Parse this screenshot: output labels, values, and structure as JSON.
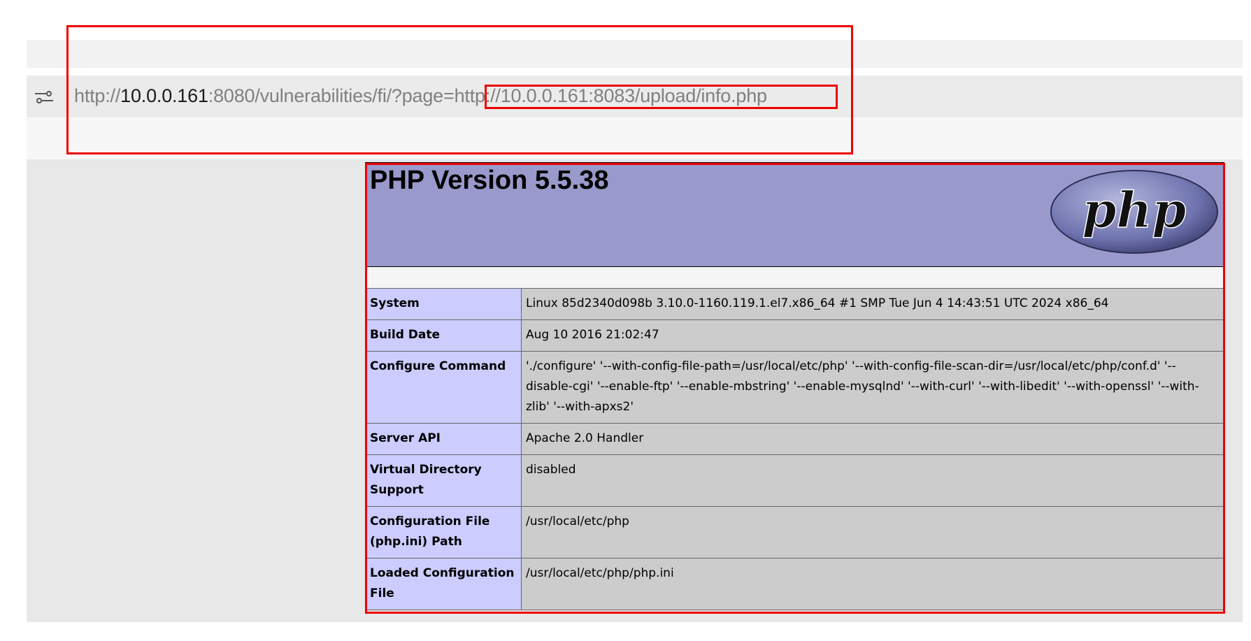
{
  "address_bar": {
    "scheme": "http://",
    "host": "10.0.0.161",
    "path_prefix": ":8080/vulnerabilities/fi/?page=",
    "page_param": "http://10.0.0.161:8083/upload/info.php",
    "site_icon": "site-settings-icon"
  },
  "phpinfo": {
    "title": "PHP Version 5.5.38",
    "logo_text": "php",
    "rows": [
      {
        "key": "System",
        "value": "Linux 85d2340d098b 3.10.0-1160.119.1.el7.x86_64 #1 SMP Tue Jun 4 14:43:51 UTC 2024 x86_64"
      },
      {
        "key": "Build Date",
        "value": "Aug 10 2016 21:02:47"
      },
      {
        "key": "Configure Command",
        "value": "'./configure' '--with-config-file-path=/usr/local/etc/php' '--with-config-file-scan-dir=/usr/local/etc/php/conf.d' '--disable-cgi' '--enable-ftp' '--enable-mbstring' '--enable-mysqlnd' '--with-curl' '--with-libedit' '--with-openssl' '--with-zlib' '--with-apxs2'"
      },
      {
        "key": "Server API",
        "value": "Apache 2.0 Handler"
      },
      {
        "key": "Virtual Directory Support",
        "value": "disabled"
      },
      {
        "key": "Configuration File (php.ini) Path",
        "value": "/usr/local/etc/php"
      },
      {
        "key": "Loaded Configuration File",
        "value": "/usr/local/etc/php/php.ini"
      }
    ]
  },
  "colors": {
    "annotation": "#ee0000",
    "php_header": "#9999cc",
    "key_cell": "#ccccff",
    "value_cell": "#cccccc"
  }
}
